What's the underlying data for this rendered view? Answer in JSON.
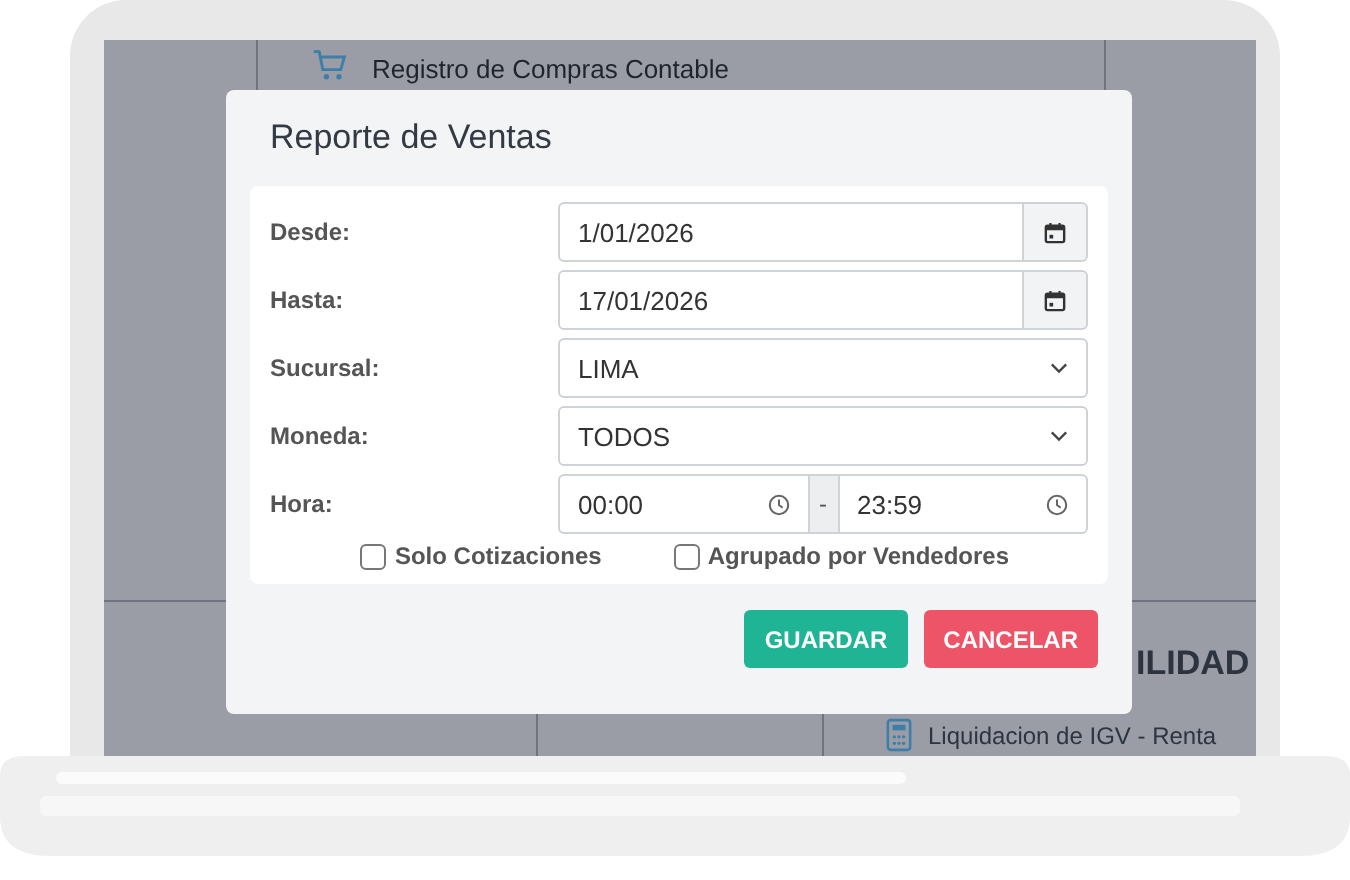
{
  "background_page": {
    "menu_item": "Registro de Compras Contable",
    "section_heading": "ILIDAD",
    "menu_item_2": "Liquidacion de IGV - Renta"
  },
  "dialog": {
    "title": "Reporte de Ventas",
    "fields": [
      {
        "label": "Desde:",
        "kind": "date",
        "value": "1/01/2026"
      },
      {
        "label": "Hasta:",
        "kind": "date",
        "value": "17/01/2026"
      },
      {
        "label": "Sucursal:",
        "kind": "select",
        "value": "LIMA"
      },
      {
        "label": "Moneda:",
        "kind": "select",
        "value": "TODOS"
      },
      {
        "label": "Hora:",
        "kind": "time_range",
        "value": "00:00",
        "separator": "-",
        "value_to": "23:59"
      }
    ],
    "checkboxes": [
      {
        "label": "Solo Cotizaciones",
        "checked": false
      },
      {
        "label": "Agrupado por Vendedores",
        "checked": false
      }
    ],
    "buttons": [
      {
        "label": "GUARDAR",
        "kind": "primary"
      },
      {
        "label": "CANCELAR",
        "kind": "danger"
      }
    ]
  }
}
